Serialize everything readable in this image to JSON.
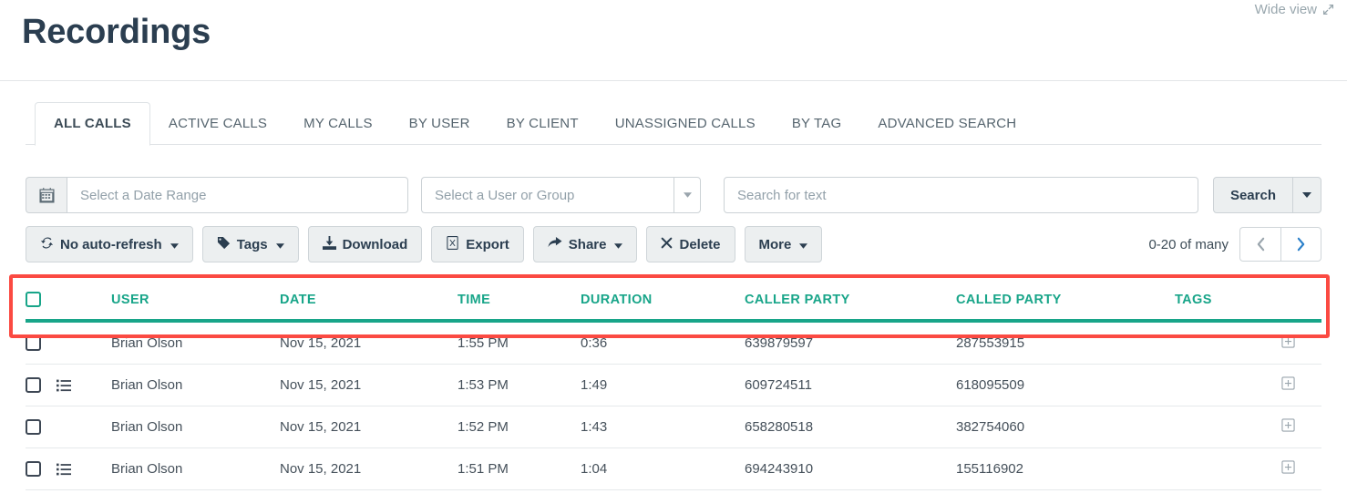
{
  "header": {
    "title": "Recordings",
    "wide_view_label": "Wide view"
  },
  "tabs": [
    {
      "label": "ALL CALLS",
      "active": true
    },
    {
      "label": "ACTIVE CALLS",
      "active": false
    },
    {
      "label": "MY CALLS",
      "active": false
    },
    {
      "label": "BY USER",
      "active": false
    },
    {
      "label": "BY CLIENT",
      "active": false
    },
    {
      "label": "UNASSIGNED CALLS",
      "active": false
    },
    {
      "label": "BY TAG",
      "active": false
    },
    {
      "label": "ADVANCED SEARCH",
      "active": false
    }
  ],
  "filters": {
    "date_range": {
      "placeholder": "Select a Date Range",
      "value": ""
    },
    "user_group": {
      "selected": "Select a User or Group"
    },
    "text_search": {
      "placeholder": "Search for text",
      "value": ""
    },
    "search_button": "Search"
  },
  "toolbar": {
    "auto_refresh": "No auto-refresh",
    "tags": "Tags",
    "download": "Download",
    "export": "Export",
    "share": "Share",
    "delete": "Delete",
    "more": "More"
  },
  "pagination": {
    "range_label": "0-20 of many"
  },
  "table": {
    "columns": [
      "USER",
      "DATE",
      "TIME",
      "DURATION",
      "CALLER PARTY",
      "CALLED PARTY",
      "TAGS"
    ],
    "rows": [
      {
        "user": "Brian Olson",
        "date": "Nov 15, 2021",
        "time": "1:55 PM",
        "duration": "0:36",
        "caller_party": "639879597",
        "called_party": "287553915",
        "tags": "",
        "has_list_icon": false
      },
      {
        "user": "Brian Olson",
        "date": "Nov 15, 2021",
        "time": "1:53 PM",
        "duration": "1:49",
        "caller_party": "609724511",
        "called_party": "618095509",
        "tags": "",
        "has_list_icon": true
      },
      {
        "user": "Brian Olson",
        "date": "Nov 15, 2021",
        "time": "1:52 PM",
        "duration": "1:43",
        "caller_party": "658280518",
        "called_party": "382754060",
        "tags": "",
        "has_list_icon": false
      },
      {
        "user": "Brian Olson",
        "date": "Nov 15, 2021",
        "time": "1:51 PM",
        "duration": "1:04",
        "caller_party": "694243910",
        "called_party": "155116902",
        "tags": "",
        "has_list_icon": true
      }
    ]
  },
  "colors": {
    "accent_teal": "#18a589",
    "annotation_red": "#fb4a42",
    "title": "#2b3e50"
  }
}
